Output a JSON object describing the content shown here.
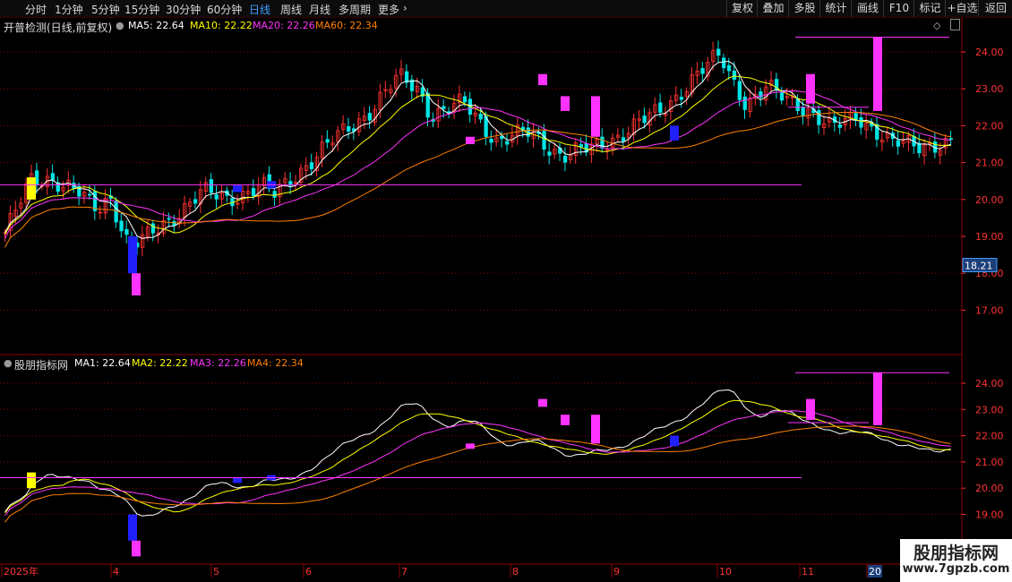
{
  "toolbar": {
    "periods": [
      {
        "label": "分时",
        "active": false
      },
      {
        "label": "1分钟",
        "active": false
      },
      {
        "label": "5分钟",
        "active": false
      },
      {
        "label": "15分钟",
        "active": false
      },
      {
        "label": "30分钟",
        "active": false
      },
      {
        "label": "60分钟",
        "active": false
      },
      {
        "label": "日线",
        "active": true
      },
      {
        "label": "周线",
        "active": false
      },
      {
        "label": "月线",
        "active": false
      },
      {
        "label": "多周期",
        "active": false
      },
      {
        "label": "更多",
        "active": false
      }
    ],
    "more_chevron": "›",
    "buttons": [
      "复权",
      "叠加",
      "多股",
      "统计",
      "画线",
      "F10",
      "标记",
      "+自选",
      "返回"
    ]
  },
  "main_header": {
    "title": "开普检测(日线,前复权)",
    "indicators": [
      {
        "label": "MA5: 22.64",
        "color": "#ffffff"
      },
      {
        "label": "MA10: 22.22",
        "color": "#ffff00"
      },
      {
        "label": "MA20: 22.26",
        "color": "#ff33ff"
      },
      {
        "label": "MA60: 22.34",
        "color": "#ff8000"
      }
    ]
  },
  "sub_header": {
    "title": "股朋指标网",
    "indicators": [
      {
        "label": "MA1: 22.64",
        "color": "#ffffff"
      },
      {
        "label": "MA2: 22.22",
        "color": "#ffff00"
      },
      {
        "label": "MA3: 22.26",
        "color": "#ff33ff"
      },
      {
        "label": "MA4: 22.34",
        "color": "#ff8000"
      }
    ]
  },
  "main_axis": [
    "24.00",
    "23.00",
    "22.00",
    "21.00",
    "20.00",
    "19.00",
    "18.00",
    "17.00"
  ],
  "sub_axis": [
    "24.00",
    "23.00",
    "22.00",
    "21.00",
    "20.00",
    "19.00"
  ],
  "price_tag": "18.21",
  "x_axis": [
    "2025年",
    "4",
    "5",
    "6",
    "7",
    "8",
    "9",
    "10",
    "11",
    "20"
  ],
  "colors": {
    "up": "#ff3232",
    "down": "#00e5e5",
    "ma5": "#ffffff",
    "ma10": "#ffff00",
    "ma20": "#ff33ff",
    "ma60": "#ff8000",
    "signal_up": "#ff33ff",
    "signal_down": "#2020ff",
    "signal_yellow": "#ffff00",
    "grid": "#8b0000",
    "axis_text": "#ff3333",
    "axis_active": "#3fa0ff"
  },
  "logo": {
    "title": "股朋指标网",
    "url": "www.7gpzb.com"
  }
}
